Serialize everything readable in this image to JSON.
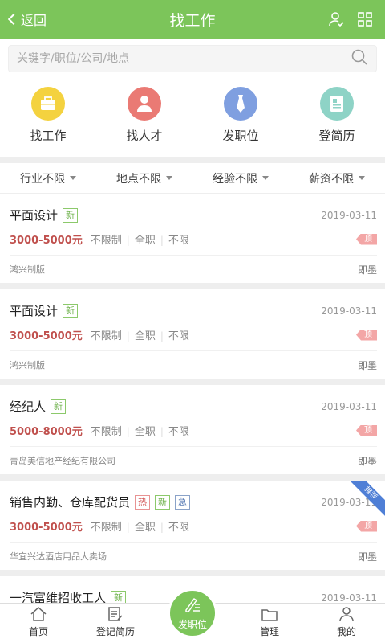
{
  "header": {
    "back_label": "返回",
    "title": "找工作"
  },
  "search": {
    "placeholder": "关键字/职位/公司/地点"
  },
  "quicknav": [
    {
      "label": "找工作",
      "icon": "briefcase-icon",
      "color": "#f4d23f"
    },
    {
      "label": "找人才",
      "icon": "person-icon",
      "color": "#ea7a74"
    },
    {
      "label": "发职位",
      "icon": "tie-icon",
      "color": "#7f9fe0"
    },
    {
      "label": "登简历",
      "icon": "resume-icon",
      "color": "#8ed3c6"
    }
  ],
  "filters": [
    "行业不限",
    "地点不限",
    "经验不限",
    "薪资不限"
  ],
  "jobs": [
    {
      "title": "平面设计",
      "tags": [
        "新"
      ],
      "date": "2019-03-11",
      "salary": "3000-5000元",
      "conds": [
        "不限制",
        "全职",
        "不限"
      ],
      "badge": "顶",
      "company": "鸿兴制版",
      "city": "即墨"
    },
    {
      "title": "平面设计",
      "tags": [
        "新"
      ],
      "date": "2019-03-11",
      "salary": "3000-5000元",
      "conds": [
        "不限制",
        "全职",
        "不限"
      ],
      "badge": "顶",
      "company": "鸿兴制版",
      "city": "即墨"
    },
    {
      "title": "经纪人",
      "tags": [
        "新"
      ],
      "date": "2019-03-11",
      "salary": "5000-8000元",
      "conds": [
        "不限制",
        "全职",
        "不限"
      ],
      "badge": "顶",
      "company": "青岛美信地产经纪有限公司",
      "city": "即墨"
    },
    {
      "title": "销售内勤、仓库配货员",
      "tags": [
        "热",
        "新",
        "急"
      ],
      "date": "2019-03-11",
      "salary": "3000-5000元",
      "conds": [
        "不限制",
        "全职",
        "不限"
      ],
      "badge": "顶",
      "company": "华宜兴达酒店用品大卖场",
      "city": "即墨",
      "ribbon": "推荐"
    },
    {
      "title": "一汽富维招收工人",
      "tags": [
        "新"
      ],
      "date": "2019-03-11"
    }
  ],
  "tabbar": {
    "home": "首页",
    "register": "登记简历",
    "post": "发职位",
    "manage": "管理",
    "mine": "我的"
  },
  "colors": {
    "brand": "#7cc55a",
    "salary": "#c0504d",
    "ribbon": "#4f7fd6"
  }
}
